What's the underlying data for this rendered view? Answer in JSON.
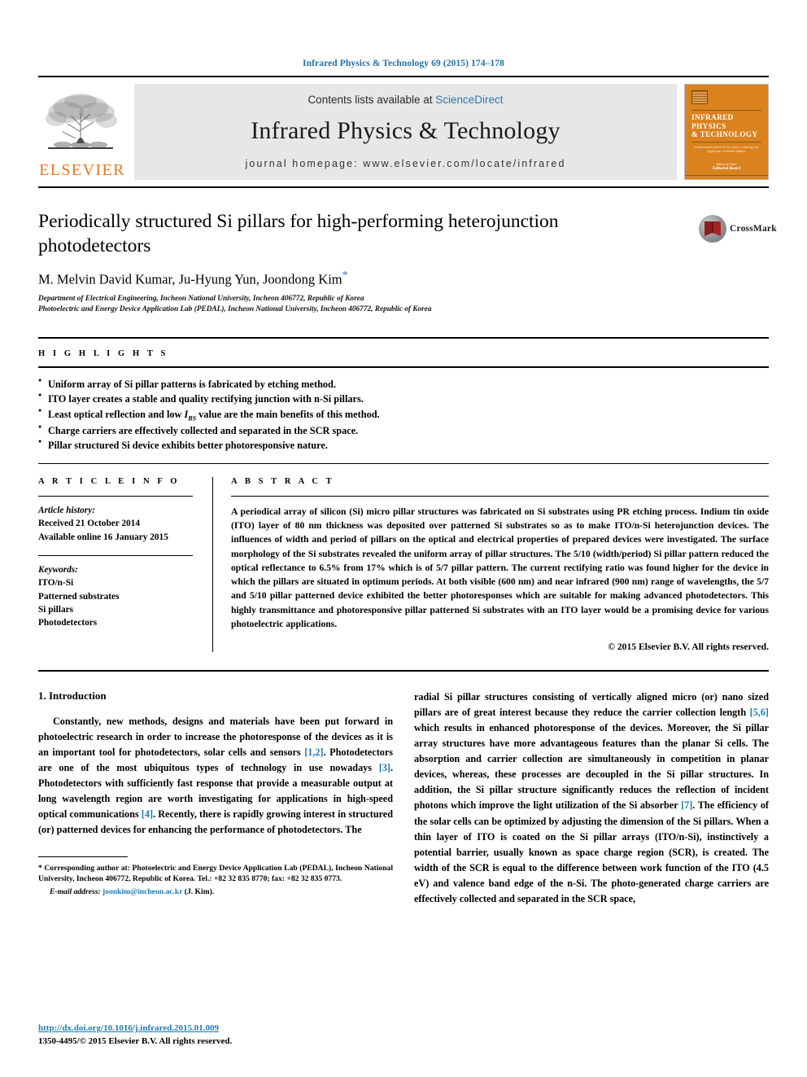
{
  "running_head": "Infrared Physics & Technology 69 (2015) 174–178",
  "masthead": {
    "contents_prefix": "Contents lists available at ",
    "sciencedirect": "ScienceDirect",
    "journal_name": "Infrared Physics & Technology",
    "homepage": "journal homepage: www.elsevier.com/locate/infrared",
    "publisher_logo_text": "ELSEVIER",
    "cover": {
      "title_line1": "INFRARED PHYSICS",
      "title_line2": "& TECHNOLOGY",
      "subtitle": "an international journal for the science, technology and applications of infrared radiation",
      "bottom_label": "Editor-in-Chief",
      "bottom_name": "Editorial Board"
    }
  },
  "article": {
    "title": "Periodically structured Si pillars for high-performing heterojunction photodetectors",
    "crossmark_label": "CrossMark",
    "authors": "M. Melvin David Kumar, Ju-Hyung Yun, Joondong Kim",
    "corresponding_marker": "*",
    "affiliations": [
      "Department of Electrical Engineering, Incheon National University, Incheon 406772, Republic of Korea",
      "Photoelectric and Energy Device Application Lab (PEDAL), Incheon National University, Incheon 406772, Republic of Korea"
    ]
  },
  "highlights": {
    "heading": "H I G H L I G H T S",
    "items": [
      "Uniform array of Si pillar patterns is fabricated by etching method.",
      "ITO layer creates a stable and quality rectifying junction with n-Si pillars.",
      "Least optical reflection and low IBS value are the main benefits of this method.",
      "Charge carriers are effectively collected and separated in the SCR space.",
      "Pillar structured Si device exhibits better photoresponsive nature."
    ],
    "item3_parts": {
      "before": "Least optical reflection and low ",
      "italic_symbol": "I",
      "subscript": "BS",
      "after": " value are the main benefits of this method."
    }
  },
  "article_info": {
    "heading": "A R T I C L E   I N F O",
    "history_label": "Article history:",
    "history": [
      "Received 21 October 2014",
      "Available online 16 January 2015"
    ],
    "keywords_label": "Keywords:",
    "keywords": [
      "ITO/n-Si",
      "Patterned substrates",
      "Si pillars",
      "Photodetectors"
    ]
  },
  "abstract": {
    "heading": "A B S T R A C T",
    "text": "A periodical array of silicon (Si) micro pillar structures was fabricated on Si substrates using PR etching process. Indium tin oxide (ITO) layer of 80 nm thickness was deposited over patterned Si substrates so as to make ITO/n-Si heterojunction devices. The influences of width and period of pillars on the optical and electrical properties of prepared devices were investigated. The surface morphology of the Si substrates revealed the uniform array of pillar structures. The 5/10 (width/period) Si pillar pattern reduced the optical reflectance to 6.5% from 17% which is of 5/7 pillar pattern. The current rectifying ratio was found higher for the device in which the pillars are situated in optimum periods. At both visible (600 nm) and near infrared (900 nm) range of wavelengths, the 5/7 and 5/10 pillar patterned device exhibited the better photoresponses which are suitable for making advanced photodetectors. This highly transmittance and photoresponsive pillar patterned Si substrates with an ITO layer would be a promising device for various photoelectric applications.",
    "copyright": "© 2015 Elsevier B.V. All rights reserved."
  },
  "body": {
    "section_number_title": "1. Introduction",
    "left_paragraph_a": "Constantly, new methods, designs and materials have been put forward in photoelectric research in order to increase the photoresponse of the devices as it is an important tool for photodetectors, solar cells and sensors ",
    "ref_12": "[1,2]",
    "left_paragraph_b": ". Photodetectors are one of the most ubiquitous types of technology in use nowadays ",
    "ref_3": "[3]",
    "left_paragraph_c": ". Photodetectors with sufficiently fast response that provide a measurable output at long wavelength region are worth investigating for applications in high-speed optical communications ",
    "ref_4": "[4]",
    "left_paragraph_d": ". Recently, there is rapidly growing interest in structured (or) patterned devices for enhancing the performance of photodetectors. The",
    "right_paragraph_a": "radial Si pillar structures consisting of vertically aligned micro (or) nano sized pillars are of great interest because they reduce the carrier collection length ",
    "ref_56": "[5,6]",
    "right_paragraph_b": " which results in enhanced photoresponse of the devices. Moreover, the Si pillar array structures have more advantageous features than the planar Si cells. The absorption and carrier collection are simultaneously in competition in planar devices, whereas, these processes are decoupled in the Si pillar structures. In addition, the Si pillar structure significantly reduces the reflection of incident photons which improve the light utilization of the Si absorber ",
    "ref_7": "[7]",
    "right_paragraph_c": ". The efficiency of the solar cells can be optimized by adjusting the dimension of the Si pillars. When a thin layer of ITO is coated on the Si pillar arrays (ITO/n-Si), instinctively a potential barrier, usually known as space charge region (SCR), is created. The width of the SCR is equal to the difference between work function of the ITO (4.5 eV) and valence band edge of the n-Si. The photo-generated charge carriers are effectively collected and separated in the SCR space,"
  },
  "footnote": {
    "marker": "*",
    "text": " Corresponding author at: Photoelectric and Energy Device Application Lab (PEDAL), Incheon National University, Incheon 406772, Republic of Korea. Tel.: +82 32 835 8770; fax: +82 32 835 0773.",
    "email_label": "E-mail address:",
    "email": "joonkim@incheon.ac.kr",
    "email_suffix": " (J. Kim)."
  },
  "page_footer": {
    "doi": "http://dx.doi.org/10.1016/j.infrared.2015.01.009",
    "issn_line": "1350-4495/© 2015 Elsevier B.V. All rights reserved."
  },
  "colors": {
    "link_blue": "#1f7bb0",
    "sciencedirect_blue": "#2a7ab0",
    "elsevier_orange": "#e87722",
    "cover_orange": "#d9821e",
    "band_gray": "#e7e7e7"
  }
}
